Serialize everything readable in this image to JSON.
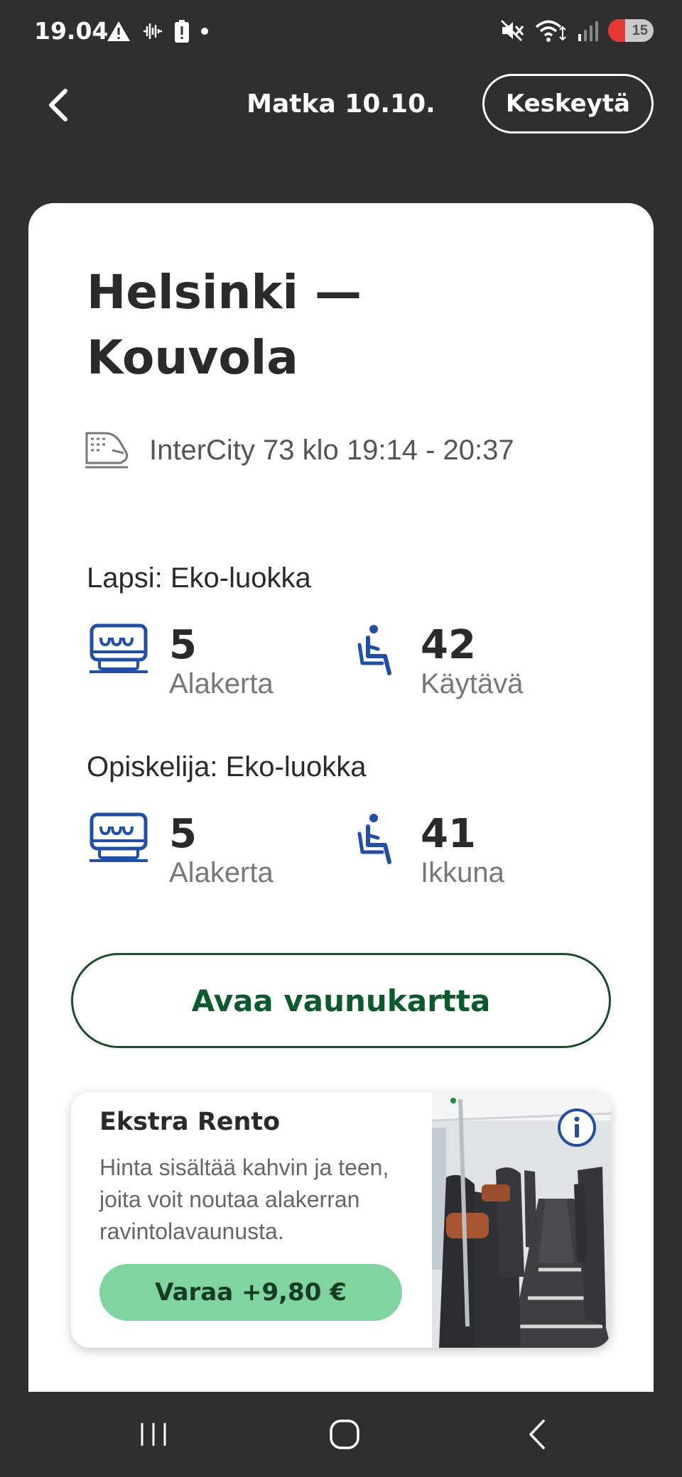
{
  "status_bar": {
    "time": "19.04",
    "battery_level": "15",
    "icons": [
      "alert-icon",
      "voicemail-icon",
      "battery-warning-icon",
      "dot-icon",
      "mute-icon",
      "wifi-icon",
      "signal-icon",
      "battery-icon"
    ]
  },
  "header": {
    "title": "Matka 10.10.",
    "cancel_label": "Keskeytä"
  },
  "trip": {
    "route_line1": "Helsinki —",
    "route_line2": "Kouvola",
    "train_info": "InterCity 73 klo 19:14 - 20:37"
  },
  "passengers": [
    {
      "label": "Lapsi: Eko-luokka",
      "car_number": "5",
      "car_level": "Alakerta",
      "seat_number": "42",
      "seat_position": "Käytävä"
    },
    {
      "label": "Opiskelija: Eko-luokka",
      "car_number": "5",
      "car_level": "Alakerta",
      "seat_number": "41",
      "seat_position": "Ikkuna"
    }
  ],
  "actions": {
    "open_map_label": "Avaa vaunukartta"
  },
  "promo": {
    "title": "Ekstra Rento",
    "description": "Hinta sisältää kahvin ja teen, joita voit noutaa ala­kerran ravintolavaunusta.",
    "button_label": "Varaa +9,80 €"
  },
  "colors": {
    "background": "#2f2f2f",
    "card": "#ffffff",
    "icon_blue": "#1f4fa8",
    "brand_green": "#0b5a2e",
    "promo_green": "#7fd4a0"
  }
}
